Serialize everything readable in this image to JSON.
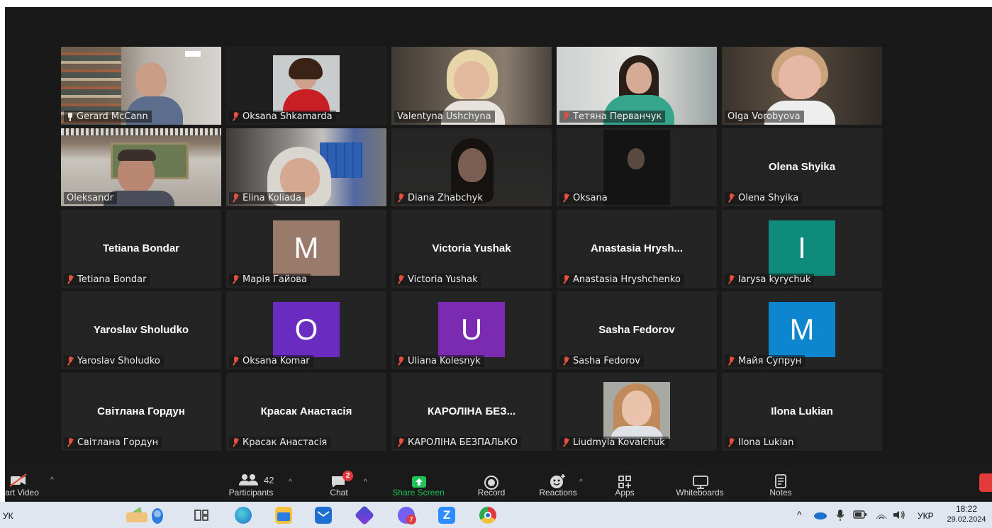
{
  "participants": [
    {
      "name": "Gerard McCann",
      "state": "video",
      "pinned": true
    },
    {
      "name": "Oksana Shkamarda",
      "state": "photo",
      "muted": true
    },
    {
      "name": "Valentyna Ushchyna",
      "state": "video",
      "active_speaker": true
    },
    {
      "name": "Тетяна Перванчук",
      "state": "video",
      "muted": true
    },
    {
      "name": "Olga Vorobyova",
      "state": "video"
    },
    {
      "name": "Oleksandr",
      "state": "video"
    },
    {
      "name": "Elina Koliada",
      "state": "video",
      "muted": true
    },
    {
      "name": "Diana Zhabchyk",
      "state": "video",
      "muted": true
    },
    {
      "name": "Oksana",
      "state": "video",
      "muted": true
    },
    {
      "name": "Olena Shyika",
      "display": "Olena Shyika",
      "state": "name",
      "muted": true
    },
    {
      "name": "Tetiana Bondar",
      "display": "Tetiana Bondar",
      "state": "name",
      "muted": true
    },
    {
      "name": "Марія Гайова",
      "letter": "M",
      "color": "#9a7b6b",
      "state": "letter",
      "muted": true
    },
    {
      "name": "Victoria Yushak",
      "display": "Victoria Yushak",
      "state": "name",
      "muted": true
    },
    {
      "name": "Anastasia Hryshchenko",
      "display": "Anastasia Hrysh...",
      "state": "name",
      "muted": true
    },
    {
      "name": "larysa kyrychuk",
      "letter": "I",
      "color": "#0e8b7b",
      "state": "letter",
      "muted": true
    },
    {
      "name": "Yaroslav Sholudko",
      "display": "Yaroslav Sholudko",
      "state": "name",
      "muted": true
    },
    {
      "name": "Oksana Komar",
      "letter": "O",
      "color": "#6a2bc0",
      "state": "letter",
      "muted": true
    },
    {
      "name": "Uliana Kolesnyk",
      "letter": "U",
      "color": "#7b2ab2",
      "state": "letter",
      "muted": true
    },
    {
      "name": "Sasha Fedorov",
      "display": "Sasha Fedorov",
      "state": "name",
      "muted": true
    },
    {
      "name": "Майя Супрун",
      "letter": "M",
      "color": "#0e86cf",
      "state": "letter",
      "muted": true
    },
    {
      "name": "Світлана Гордун",
      "display": "Світлана Гордун",
      "state": "name",
      "muted": true
    },
    {
      "name": "Красак Анастасія",
      "display": "Красак Анастасія",
      "state": "name",
      "muted": true
    },
    {
      "name": "КАРОЛІНА БЕЗПАЛЬКО",
      "display": "КАРОЛІНА БЕЗ...",
      "state": "name",
      "muted": true
    },
    {
      "name": "Liudmyla Kovalchuk",
      "state": "photo",
      "muted": true
    },
    {
      "name": "Ilona Lukian",
      "display": "Ilona Lukian",
      "state": "name",
      "muted": true
    }
  ],
  "toolbar": {
    "video_label": "art Video",
    "participants_label": "Participants",
    "participants_count": "42",
    "chat_label": "Chat",
    "chat_badge": "2",
    "share_label": "Share Screen",
    "record_label": "Record",
    "reactions_label": "Reactions",
    "apps_label": "Apps",
    "whiteboards_label": "Whiteboards",
    "notes_label": "Notes"
  },
  "taskbar": {
    "lang_left": "УК",
    "lang_tray": "УКР",
    "time": "18:22",
    "date": "29.02.2024",
    "viber_badge": "7"
  },
  "colors": {
    "active_speaker_border": "#c8d940",
    "share_green": "#20c356",
    "muted_red": "#e3503e"
  }
}
